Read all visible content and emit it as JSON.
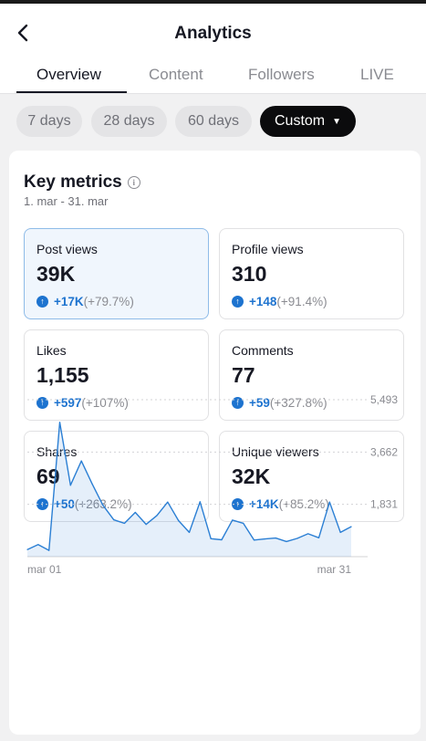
{
  "header": {
    "title": "Analytics",
    "tabs": [
      {
        "label": "Overview",
        "active": true
      },
      {
        "label": "Content",
        "active": false
      },
      {
        "label": "Followers",
        "active": false
      },
      {
        "label": "LIVE",
        "active": false
      }
    ]
  },
  "filters": {
    "chips": [
      {
        "label": "7 days",
        "selected": false
      },
      {
        "label": "28 days",
        "selected": false
      },
      {
        "label": "60 days",
        "selected": false
      },
      {
        "label": "Custom",
        "selected": true
      }
    ]
  },
  "key_metrics": {
    "title": "Key metrics",
    "date_range": "1. mar - 31. mar",
    "metrics": [
      {
        "label": "Post views",
        "value": "39K",
        "delta": "+17K",
        "pct": "(+79.7%)",
        "selected": true
      },
      {
        "label": "Profile views",
        "value": "310",
        "delta": "+148",
        "pct": "(+91.4%)",
        "selected": false
      },
      {
        "label": "Likes",
        "value": "1,155",
        "delta": "+597",
        "pct": "(+107%)",
        "selected": false
      },
      {
        "label": "Comments",
        "value": "77",
        "delta": "+59",
        "pct": "(+327.8%)",
        "selected": false
      },
      {
        "label": "Shares",
        "value": "69",
        "delta": "+50",
        "pct": "(+263.2%)",
        "selected": false
      },
      {
        "label": "Unique viewers",
        "value": "32K",
        "delta": "+14K",
        "pct": "(+85.2%)",
        "selected": false
      }
    ]
  },
  "chart": {
    "y_ticks": [
      "5,493",
      "3,662",
      "1,831"
    ],
    "x_start": "mar 01",
    "x_end": "mar 31",
    "color": "#2b7fd4"
  },
  "chart_data": {
    "type": "area",
    "x": [
      1,
      2,
      3,
      4,
      5,
      6,
      7,
      8,
      9,
      10,
      11,
      12,
      13,
      14,
      15,
      16,
      17,
      18,
      19,
      20,
      21,
      22,
      23,
      24,
      25,
      26,
      27,
      28,
      29,
      30,
      31
    ],
    "y": [
      250,
      420,
      220,
      4700,
      2500,
      3350,
      2550,
      1800,
      1290,
      1170,
      1550,
      1130,
      1440,
      1910,
      1260,
      850,
      1920,
      630,
      590,
      1280,
      1170,
      580,
      620,
      650,
      530,
      640,
      800,
      660,
      1910,
      850,
      1050
    ],
    "y_ticks": [
      1831,
      3662,
      5493
    ],
    "ylim": [
      0,
      5493
    ],
    "grid": true
  }
}
